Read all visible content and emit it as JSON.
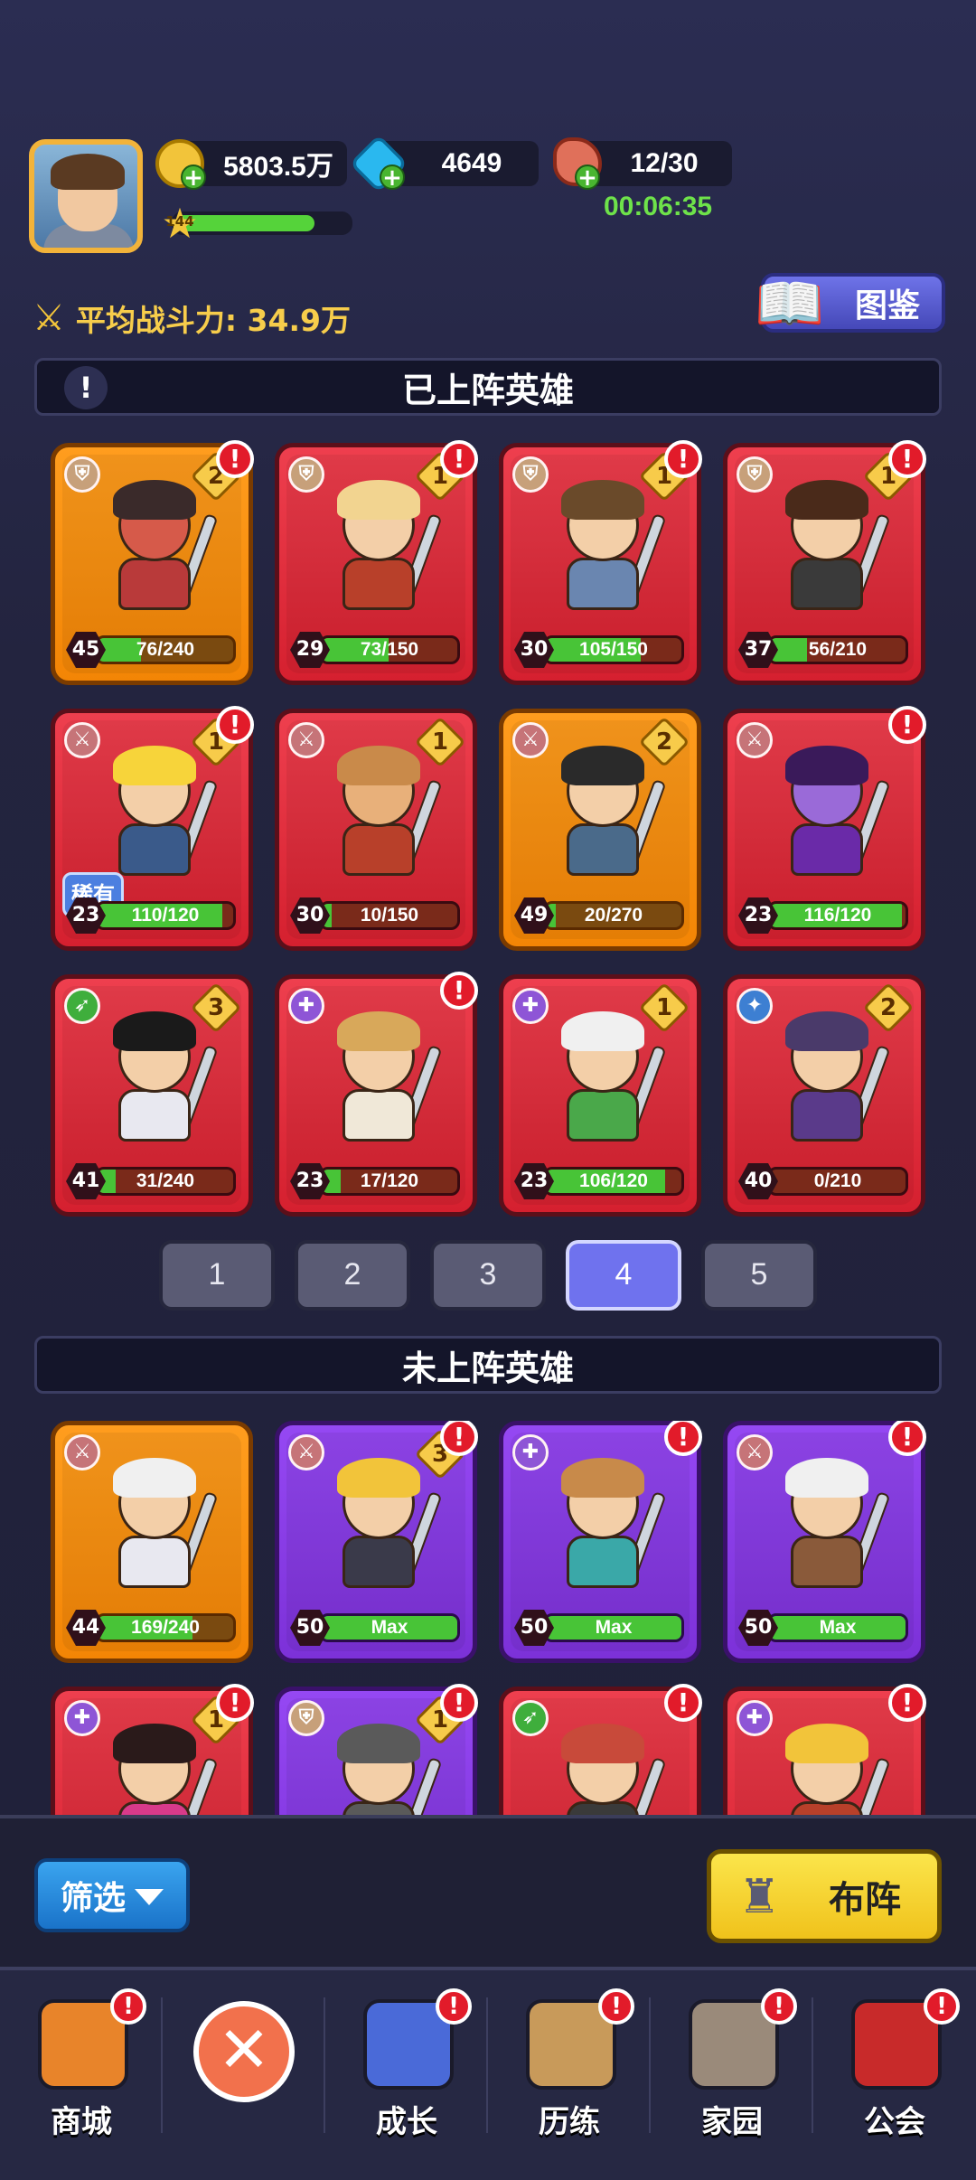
{
  "player": {
    "level": "144",
    "xp_fraction": 0.8
  },
  "resources": {
    "gold": "5803.5万",
    "gems": "4649",
    "stamina": "12/30",
    "stamina_timer": "00:06:35"
  },
  "header": {
    "avg_power": "平均战斗力: 34.9万",
    "codex_label": "图鉴"
  },
  "deployed_section": {
    "title": "已上阵英雄",
    "heroes": [
      {
        "level": "45",
        "progress": "76/240",
        "fill": 0.32,
        "stars": "2",
        "rarity": "orange",
        "class": "shield",
        "alert": true,
        "hair": "#3a2a2a",
        "body": "#b93a3a",
        "skin": "#d65a4a"
      },
      {
        "level": "29",
        "progress": "73/150",
        "fill": 0.49,
        "stars": "1",
        "rarity": "red",
        "class": "shield",
        "alert": true,
        "hair": "#f2d490",
        "body": "#b8402a",
        "skin": "#f3cfa8"
      },
      {
        "level": "30",
        "progress": "105/150",
        "fill": 0.7,
        "stars": "1",
        "rarity": "red",
        "class": "shield",
        "alert": true,
        "hair": "#6a4a2a",
        "body": "#6a86b0",
        "skin": "#f3cfa8"
      },
      {
        "level": "37",
        "progress": "56/210",
        "fill": 0.27,
        "stars": "1",
        "rarity": "red",
        "class": "shield",
        "alert": true,
        "hair": "#4a2a1a",
        "body": "#3a3a3a",
        "skin": "#f3cfa8"
      },
      {
        "level": "23",
        "progress": "110/120",
        "fill": 0.92,
        "stars": "1",
        "rarity": "red",
        "class": "sword",
        "alert": true,
        "hair": "#f7d43a",
        "body": "#3a5a8a",
        "skin": "#f3cfa8",
        "tag": "稀有"
      },
      {
        "level": "30",
        "progress": "10/150",
        "fill": 0.07,
        "stars": "1",
        "rarity": "red",
        "class": "sword",
        "alert": false,
        "hair": "#c98a4a",
        "body": "#b8402a",
        "skin": "#e8b07a"
      },
      {
        "level": "49",
        "progress": "20/270",
        "fill": 0.07,
        "stars": "2",
        "rarity": "orange",
        "class": "sword",
        "alert": false,
        "hair": "#2a2a2a",
        "body": "#4a6a8a",
        "skin": "#f3cfa8"
      },
      {
        "level": "23",
        "progress": "116/120",
        "fill": 0.97,
        "stars": "",
        "rarity": "red",
        "class": "sword",
        "alert": true,
        "hair": "#3a1a5a",
        "body": "#6a2aa8",
        "skin": "#9a6ad8"
      },
      {
        "level": "41",
        "progress": "31/240",
        "fill": 0.13,
        "stars": "3",
        "rarity": "red",
        "class": "bow",
        "alert": false,
        "hair": "#1a1a1a",
        "body": "#e8e8f0",
        "skin": "#f3cfa8"
      },
      {
        "level": "23",
        "progress": "17/120",
        "fill": 0.14,
        "stars": "",
        "rarity": "red",
        "class": "heal",
        "alert": true,
        "hair": "#d8a85a",
        "body": "#f0e8d8",
        "skin": "#f3cfa8"
      },
      {
        "level": "23",
        "progress": "106/120",
        "fill": 0.88,
        "stars": "1",
        "rarity": "red",
        "class": "heal",
        "alert": false,
        "hair": "#f0f0f0",
        "body": "#4aa84a",
        "skin": "#f3cfa8"
      },
      {
        "level": "40",
        "progress": "0/210",
        "fill": 0.0,
        "stars": "2",
        "rarity": "red",
        "class": "magic",
        "alert": false,
        "hair": "#4a3a6a",
        "body": "#5a3a8a",
        "skin": "#f3cfa8"
      }
    ]
  },
  "pager": {
    "pages": [
      "1",
      "2",
      "3",
      "4",
      "5"
    ],
    "active": "4"
  },
  "undeployed_section": {
    "title": "未上阵英雄",
    "heroes": [
      {
        "level": "44",
        "progress": "169/240",
        "fill": 0.7,
        "stars": "",
        "rarity": "orange",
        "class": "sword",
        "alert": false,
        "hair": "#f0f0f0",
        "body": "#e8e8f0",
        "skin": "#f3cfa8"
      },
      {
        "level": "50",
        "progress": "Max",
        "fill": 1.0,
        "stars": "3",
        "rarity": "purple",
        "class": "sword",
        "alert": true,
        "hair": "#f2c43a",
        "body": "#3a3a4a",
        "skin": "#f3cfa8"
      },
      {
        "level": "50",
        "progress": "Max",
        "fill": 1.0,
        "stars": "",
        "rarity": "purple",
        "class": "heal",
        "alert": true,
        "hair": "#c88a4a",
        "body": "#3aa8a8",
        "skin": "#f3cfa8"
      },
      {
        "level": "50",
        "progress": "Max",
        "fill": 1.0,
        "stars": "",
        "rarity": "purple",
        "class": "sword",
        "alert": true,
        "hair": "#f0f0f0",
        "body": "#8a5a3a",
        "skin": "#f3cfa8"
      },
      {
        "level": "",
        "progress": "",
        "fill": 0,
        "stars": "1",
        "rarity": "red",
        "class": "heal",
        "alert": true,
        "hair": "#2a1a1a",
        "body": "#d83a8a",
        "skin": "#f3cfa8"
      },
      {
        "level": "",
        "progress": "",
        "fill": 0,
        "stars": "1",
        "rarity": "purple",
        "class": "shield",
        "alert": true,
        "hair": "#5a5a5a",
        "body": "#5a5a5a",
        "skin": "#f3cfa8"
      },
      {
        "level": "",
        "progress": "",
        "fill": 0,
        "stars": "",
        "rarity": "red",
        "class": "bow",
        "alert": true,
        "hair": "#c84a3a",
        "body": "#3a3a3a",
        "skin": "#f3cfa8"
      },
      {
        "level": "",
        "progress": "",
        "fill": 0,
        "stars": "",
        "rarity": "red",
        "class": "heal",
        "alert": true,
        "hair": "#f2c43a",
        "body": "#b8402a",
        "skin": "#f3cfa8"
      }
    ]
  },
  "action_bar": {
    "filter_label": "筛选",
    "formation_label": "布阵"
  },
  "nav": {
    "items": [
      {
        "label": "商城",
        "icon": "shop-icon",
        "alert": true
      },
      {
        "label": "",
        "icon": "close-icon",
        "alert": false
      },
      {
        "label": "成长",
        "icon": "growth-icon",
        "alert": true
      },
      {
        "label": "历练",
        "icon": "scroll-icon",
        "alert": true
      },
      {
        "label": "家园",
        "icon": "castle-icon",
        "alert": true
      },
      {
        "label": "公会",
        "icon": "guild-shield-icon",
        "alert": true
      }
    ]
  },
  "colors": {
    "red_card": "#e22f3f",
    "orange_card": "#f7930f",
    "purple_card": "#8a3ee8",
    "xp_green": "#55d33a",
    "active_page": "#6f72ee"
  }
}
